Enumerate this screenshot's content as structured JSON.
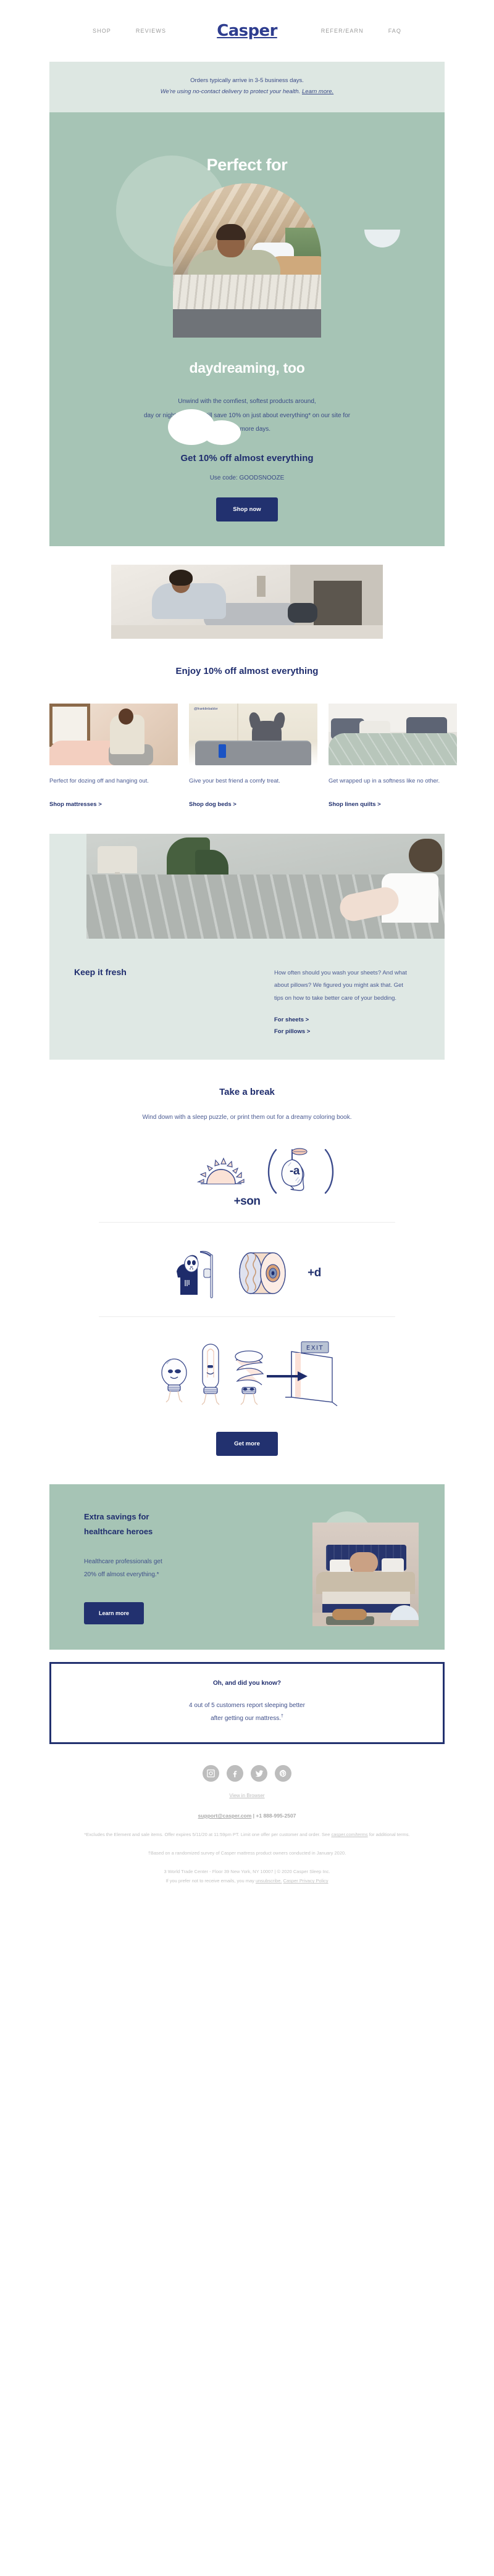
{
  "nav": {
    "left": [
      {
        "label": "SHOP",
        "name": "nav-shop"
      },
      {
        "label": "REVIEWS",
        "name": "nav-reviews"
      }
    ],
    "logo": "Casper",
    "right": [
      {
        "label": "REFER/EARN",
        "name": "nav-refer-earn"
      },
      {
        "label": "FAQ",
        "name": "nav-faq"
      }
    ]
  },
  "announce": {
    "line1": "Orders typically arrive in 3-5 business days.",
    "line2": "We're using no-contact delivery to protect your health.",
    "link": "Learn more."
  },
  "hero": {
    "title": "Perfect for",
    "subtitle": "daydreaming, too",
    "copy_line1": "Unwind with the comfiest, softest products around,",
    "copy_line2": "day or night. You can still save 10% on just about everything* on our site for",
    "copy_line3": "a few more days.",
    "offer": "Get 10% off almost everything",
    "code": "Use code: GOODSNOOZE",
    "cta": "Shop now"
  },
  "tiles_section": {
    "heading": "Enjoy 10% off almost everything",
    "tiles": [
      {
        "text": "Perfect for dozing off and hanging out.",
        "link": "Shop mattresses >",
        "name": "tile-mattresses"
      },
      {
        "text": "Give your best friend a comfy treat.",
        "link": "Shop dog beds >",
        "name": "tile-dog-beds",
        "handle": "@franklinbaldor"
      },
      {
        "text": "Get wrapped up in a softness like no other.",
        "link": "Shop linen quilts >",
        "name": "tile-linen-quilts"
      }
    ]
  },
  "fresh": {
    "heading": "Keep it fresh",
    "body": "How often should you wash your sheets? And what about pillows? We figured you might ask that. Get tips on how to take better care of your bedding.",
    "link_sheets": "For sheets >",
    "link_pillows": "For pillows >"
  },
  "break": {
    "title": "Take a break",
    "subtitle": "Wind down with a sleep puzzle, or print them out for a dreamy coloring book.",
    "puzzles": [
      {
        "name": "puzzle-sunrise-pear-son",
        "tokens": [
          "sunrise-icon",
          "pear-icon",
          "-a",
          "+son"
        ]
      },
      {
        "name": "puzzle-reaper-reel-d",
        "tokens": [
          "grim-reaper-icon",
          "film-reel-icon",
          "+d"
        ]
      },
      {
        "name": "puzzle-lightbulbs-exit",
        "tokens": [
          "light-bulbs-icon",
          "exit-door-icon"
        ]
      }
    ],
    "cta": "Get more"
  },
  "health": {
    "title_line1": "Extra savings for",
    "title_line2": "healthcare heroes",
    "copy_line1": "Healthcare professionals get",
    "copy_line2": "20% off almost everything.*",
    "cta": "Learn more"
  },
  "did_you_know": {
    "title": "Oh, and did you know?",
    "line1": "4 out of 5 customers report sleeping better",
    "line2": "after getting our mattress.",
    "dagger": "†"
  },
  "footer": {
    "socials": [
      {
        "name": "instagram-icon",
        "label": "Instagram"
      },
      {
        "name": "facebook-icon",
        "label": "Facebook"
      },
      {
        "name": "twitter-icon",
        "label": "Twitter"
      },
      {
        "name": "pinterest-icon",
        "label": "Pinterest"
      }
    ],
    "view_in_browser": "View in Browser",
    "contact_email": "support@casper.com",
    "contact_separator": " | ",
    "contact_phone": "+1 888-995-2507",
    "terms_line": "*Excludes the Element and sale items. Offer expires 5/11/20 at 11:59pm PT. Limit one offer per customer and order. See",
    "terms_link": "casper.com/terms",
    "terms_tail": " for additional terms.",
    "survey_line": "†Based on a randomized survey of Casper mattress product owners conducted in January 2020.",
    "address_line": "3 World Trade Center - Floor 39 New York, NY 10007 | © 2020 Casper Sleep Inc.",
    "unsub_prefix": "If you prefer not to receive emails, you may ",
    "unsub_link": "unsubscribe.",
    "privacy_link": "Casper Privacy Policy"
  },
  "colors": {
    "brand_navy": "#22316f",
    "hero_green": "#a6c4b5",
    "pale_green": "#dde7e2",
    "fresh_green": "#dfe8e4",
    "text_blue": "#3a4a86",
    "muted_gray": "#bdbdbd"
  }
}
